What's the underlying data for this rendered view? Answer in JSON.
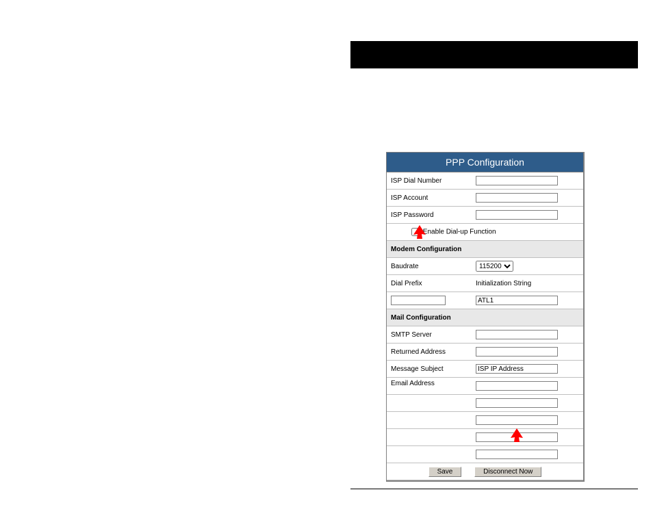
{
  "panel": {
    "title": "PPP Configuration",
    "isp_dial_number_label": "ISP Dial Number",
    "isp_dial_number_value": "",
    "isp_account_label": "ISP Account",
    "isp_account_value": "",
    "isp_password_label": "ISP Password",
    "isp_password_value": "",
    "enable_dialup_label": "Enable Dial-up Function",
    "modem_header": "Modem Configuration",
    "baudrate_label": "Baudrate",
    "baudrate_value": "115200",
    "dial_prefix_label": "Dial Prefix",
    "dial_prefix_value": "",
    "init_string_label": "Initialization String",
    "init_string_value": "ATL1",
    "mail_header": "Mail Configuration",
    "smtp_label": "SMTP Server",
    "smtp_value": "",
    "returned_label": "Returned Address",
    "returned_value": "",
    "subject_label": "Message Subject",
    "subject_value": "ISP IP Address",
    "email_label": "Email Address",
    "email1": "",
    "email2": "",
    "email3": "",
    "email4": "",
    "email5": "",
    "save_btn": "Save",
    "disconnect_btn": "Disconnect Now"
  }
}
